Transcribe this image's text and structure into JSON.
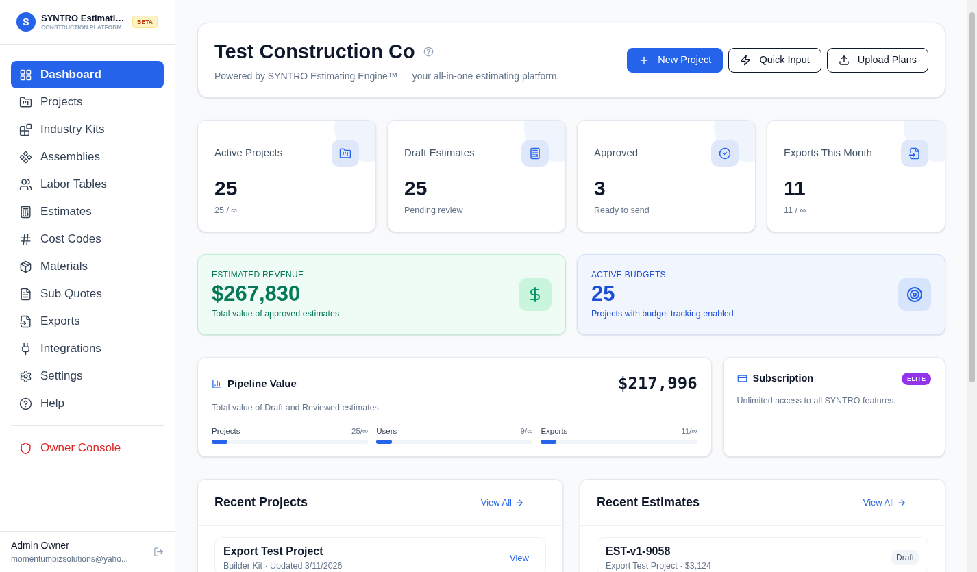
{
  "brand": {
    "logo_letter": "S",
    "name": "SYNTRO Estimati…",
    "tagline": "CONSTRUCTION PLATFORM",
    "badge": "BETA"
  },
  "nav": [
    {
      "label": "Dashboard",
      "selected": true
    },
    {
      "label": "Projects",
      "selected": false
    },
    {
      "label": "Industry Kits",
      "selected": false
    },
    {
      "label": "Assemblies",
      "selected": false
    },
    {
      "label": "Labor Tables",
      "selected": false
    },
    {
      "label": "Estimates",
      "selected": false
    },
    {
      "label": "Cost Codes",
      "selected": false
    },
    {
      "label": "Materials",
      "selected": false
    },
    {
      "label": "Sub Quotes",
      "selected": false
    },
    {
      "label": "Exports",
      "selected": false
    },
    {
      "label": "Integrations",
      "selected": false
    },
    {
      "label": "Settings",
      "selected": false
    },
    {
      "label": "Help",
      "selected": false
    }
  ],
  "owner_console": {
    "label": "Owner Console",
    "selected": false
  },
  "user": {
    "name": "Admin Owner",
    "email": "momentumbizsolutions@yaho..."
  },
  "header": {
    "title": "Test Construction Co",
    "subtitle": "Powered by SYNTRO Estimating Engine™ — your all-in-one estimating platform.",
    "buttons": [
      {
        "label": "New Project",
        "kind": "primary"
      },
      {
        "label": "Quick Input",
        "kind": "outline"
      },
      {
        "label": "Upload Plans",
        "kind": "outline"
      }
    ]
  },
  "stats": [
    {
      "label": "Active Projects",
      "value": "25",
      "sub": "25 / ∞"
    },
    {
      "label": "Draft Estimates",
      "value": "25",
      "sub": "Pending review"
    },
    {
      "label": "Approved",
      "value": "3",
      "sub": "Ready to send"
    },
    {
      "label": "Exports This Month",
      "value": "11",
      "sub": "11 / ∞"
    }
  ],
  "highlights": [
    {
      "label": "ESTIMATED REVENUE",
      "value": "$267,830",
      "sub": "Total value of approved estimates",
      "color": "#047857"
    },
    {
      "label": "ACTIVE BUDGETS",
      "value": "25",
      "sub": "Projects with budget tracking enabled",
      "color": "#1d4ed8"
    }
  ],
  "pipeline": {
    "title": "Pipeline Value",
    "value": "$217,996",
    "subtitle": "Total value of Draft and Reviewed estimates",
    "meters": [
      {
        "label": "Projects",
        "reading": "25/∞",
        "level": 0.1
      },
      {
        "label": "Users",
        "reading": "9/∞",
        "level": 0.1
      },
      {
        "label": "Exports",
        "reading": "11/∞",
        "level": 0.1
      }
    ]
  },
  "subscription": {
    "title": "Subscription",
    "badge": "ELITE",
    "text": "Unlimited access to all SYNTRO features."
  },
  "recent_projects": {
    "title": "Recent Projects",
    "link": "View All",
    "items": [
      {
        "name": "Export Test Project",
        "meta": "Builder Kit · Updated 3/11/2026",
        "action": "View"
      }
    ]
  },
  "recent_estimates": {
    "title": "Recent Estimates",
    "link": "View All",
    "items": [
      {
        "name": "EST-v1-9058",
        "meta": "Export Test Project · $3,124",
        "status": "Draft"
      }
    ]
  }
}
